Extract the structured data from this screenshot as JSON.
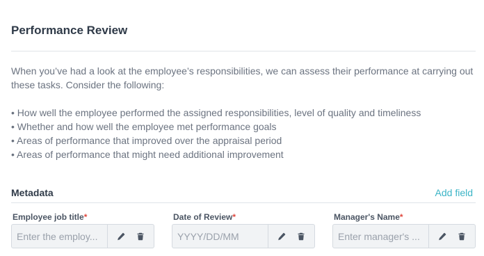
{
  "section": {
    "title": "Performance Review",
    "intro": "When you’ve had a look at the employee’s responsibilities, we can assess their performance at carrying out these tasks. Consider the following:",
    "bullets": [
      "• How well the employee performed the assigned responsibilities, level of quality and timeliness",
      "• Whether and how well the employee met performance goals",
      "• Areas of performance that improved over the appraisal period",
      "• Areas of performance that might need additional improvement"
    ]
  },
  "metadata": {
    "title": "Metadata",
    "add_field_label": "Add field",
    "required_marker": "*",
    "fields": [
      {
        "label": "Employee job title",
        "placeholder": "Enter the employ...",
        "edit_icon": "pencil-icon",
        "delete_icon": "trash-icon"
      },
      {
        "label": "Date of Review",
        "placeholder": "YYYY/DD/MM",
        "edit_icon": "pencil-icon",
        "delete_icon": "trash-icon"
      },
      {
        "label": "Manager's Name",
        "placeholder": "Enter manager's ...",
        "edit_icon": "pencil-icon",
        "delete_icon": "trash-icon"
      }
    ]
  },
  "colors": {
    "accent": "#3bb4c6",
    "required": "#e0483e",
    "input_bg": "#f1f3f5"
  }
}
